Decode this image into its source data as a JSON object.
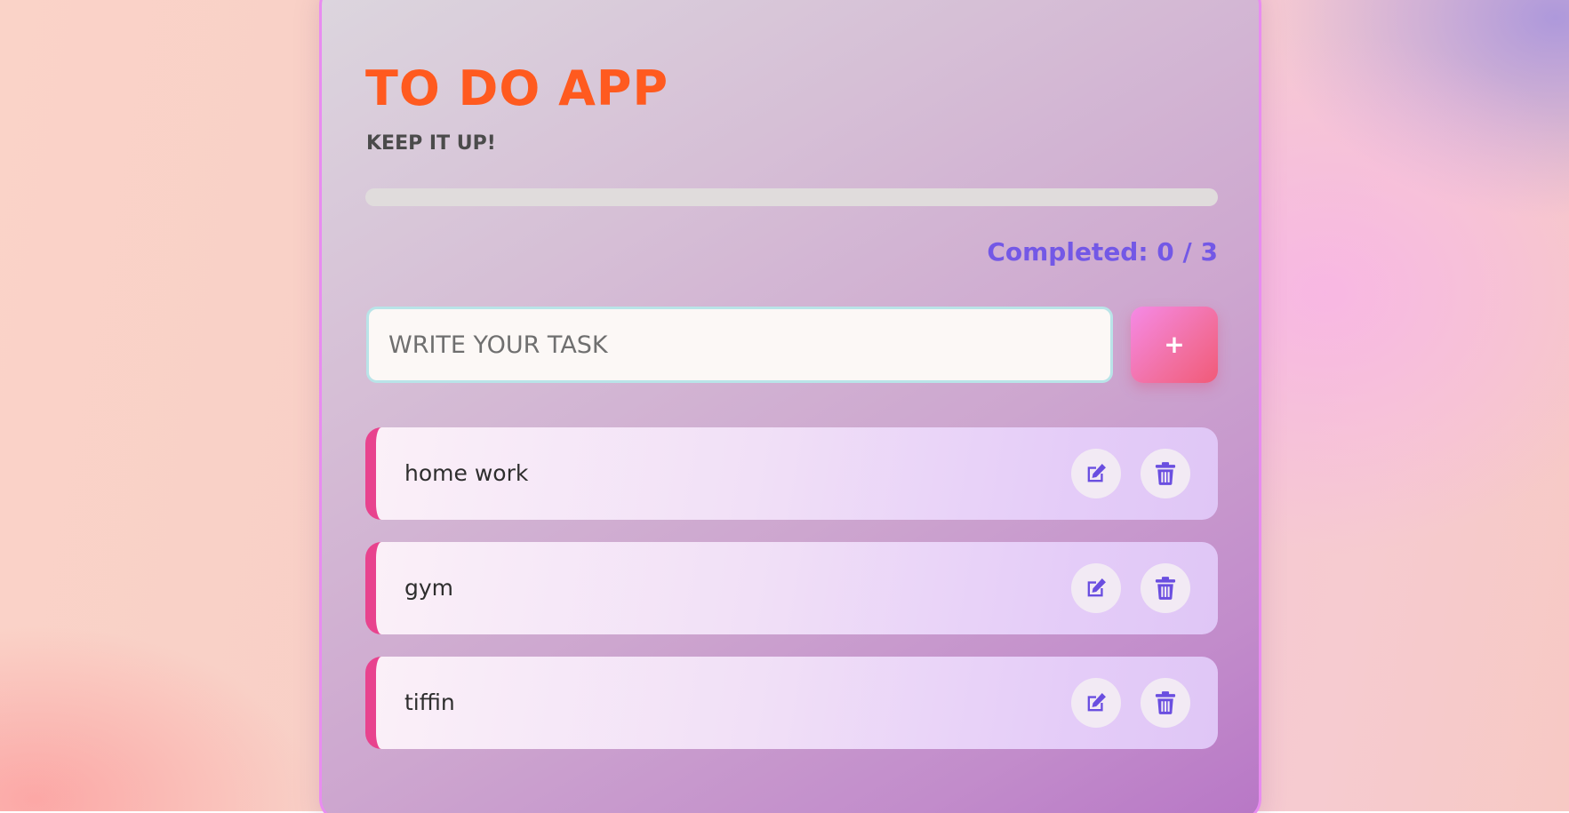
{
  "app": {
    "title": "TO DO APP",
    "subtitle": "KEEP IT UP!"
  },
  "progress": {
    "completed_fraction": 0,
    "completed_text": "Completed: 0 / 3"
  },
  "input": {
    "placeholder": "WRITE YOUR TASK",
    "value": ""
  },
  "add_button": {
    "label": "+"
  },
  "tasks": [
    {
      "text": "home work"
    },
    {
      "text": "gym"
    },
    {
      "text": "tiffin"
    }
  ],
  "icons": {
    "edit": "edit-icon",
    "delete": "trash-icon"
  },
  "colors": {
    "title": "#ff5a1f",
    "accent": "#7358e6",
    "task_border": "#e8438e",
    "add_button": "#f26fa0"
  }
}
